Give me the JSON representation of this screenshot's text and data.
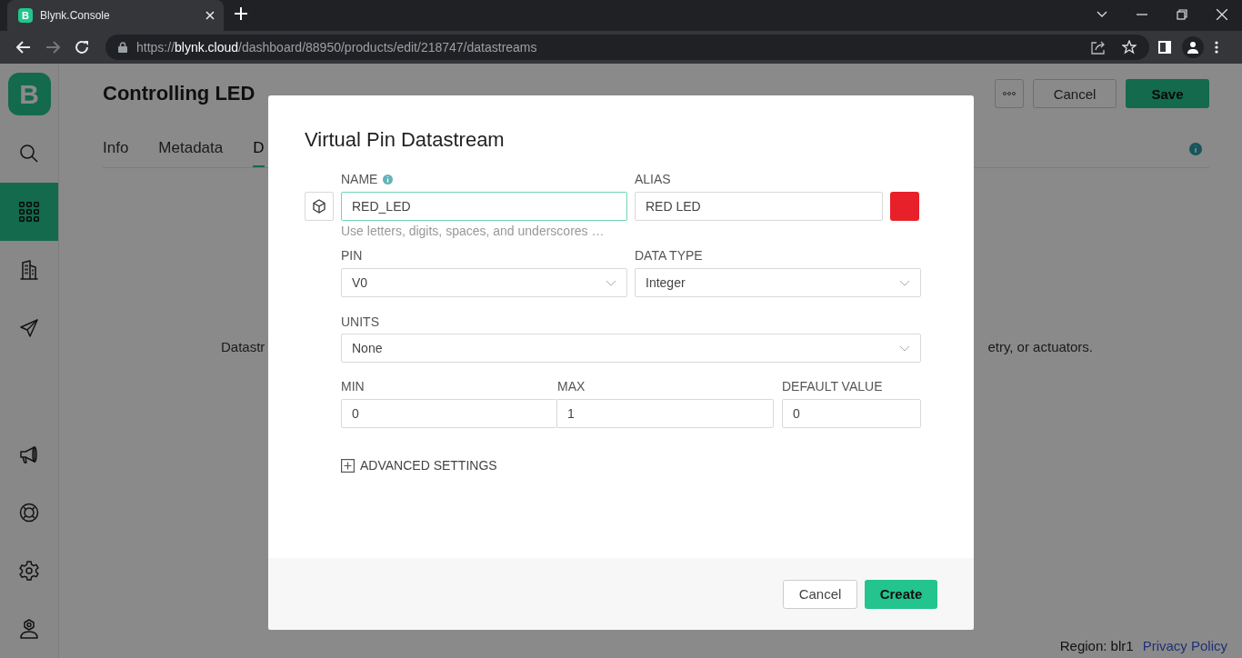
{
  "browser": {
    "tab": {
      "favicon": "B",
      "title": "Blynk.Console"
    },
    "forward": {
      "disabled": true
    },
    "url": {
      "scheme": "https://",
      "host": "blynk.cloud",
      "path": "/dashboard/88950/products/edit/218747/datastreams"
    }
  },
  "sidebar": {
    "logo": "B",
    "top_items": [
      {
        "kind": "search",
        "selected": false
      },
      {
        "kind": "grid",
        "selected": true
      },
      {
        "kind": "building",
        "selected": false
      },
      {
        "kind": "send",
        "selected": false
      }
    ],
    "bottom_items": [
      {
        "kind": "megaphone",
        "selected": false
      },
      {
        "kind": "lifebuoy",
        "selected": false
      },
      {
        "kind": "settings",
        "selected": false
      },
      {
        "kind": "user",
        "selected": false
      }
    ]
  },
  "header": {
    "title": "Controlling LED",
    "buttons": [
      {
        "kind": "more"
      },
      {
        "kind": "secondary",
        "label": "Cancel"
      },
      {
        "kind": "primary",
        "label": "Save"
      }
    ]
  },
  "tabs": [
    {
      "label": "Info",
      "selected": false
    },
    {
      "label": "Metadata",
      "selected": false
    },
    {
      "label": "D",
      "selected": true
    }
  ],
  "empty_text": {
    "left": "Datastr",
    "right": "etry, or actuators."
  },
  "footer": {
    "region": "Region: blr1",
    "link": "Privacy Policy"
  },
  "dialog": {
    "title": "Virtual Pin Datastream",
    "name": {
      "label": "NAME",
      "value": "RED_LED",
      "hint": "Use letters, digits, spaces, and underscores …",
      "focused": true
    },
    "alias": {
      "label": "ALIAS",
      "value": "RED LED"
    },
    "swatch": {
      "color": "#e8202a"
    },
    "pin": {
      "label": "PIN",
      "value": "V0"
    },
    "data_type": {
      "label": "DATA TYPE",
      "value": "Integer"
    },
    "units": {
      "label": "UNITS",
      "value": "None"
    },
    "min": {
      "label": "MIN",
      "value": "0"
    },
    "max": {
      "label": "MAX",
      "value": "1"
    },
    "default": {
      "label": "DEFAULT VALUE",
      "value": "0"
    },
    "advanced": {
      "label": "ADVANCED SETTINGS",
      "expanded": false
    },
    "buttons": [
      {
        "kind": "secondary",
        "label": "Cancel"
      },
      {
        "kind": "primary",
        "label": "Create"
      }
    ]
  }
}
